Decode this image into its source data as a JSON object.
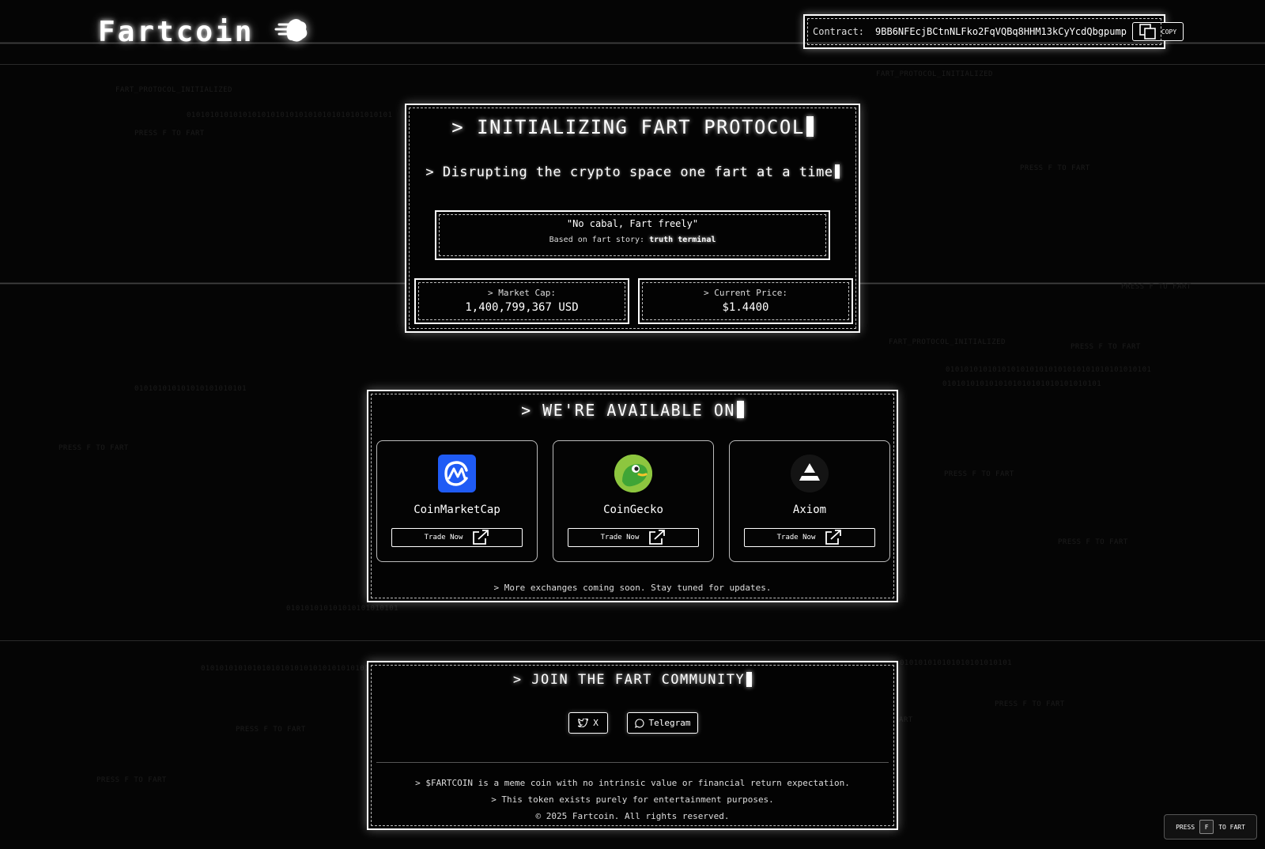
{
  "header": {
    "logo_text": "Fartcoin",
    "logo_icon": "fart-cloud-icon",
    "contract_label": "Contract:",
    "contract_address": "9BB6NFEcjBCtnNLFko2FqVQBq8HHM13kCyYcdQbgpump",
    "copy_label": "COPY"
  },
  "background_text": {
    "protocol": "FART_PROTOCOL_INITIALIZED",
    "press": "PRESS F TO FART",
    "binary_long": "01010101010101010101010101010101010101010101",
    "binary_mid": "0101010101010101010101010101010101",
    "binary_short": "010101010101010101010101"
  },
  "hero": {
    "heading": "> INITIALIZING FART PROTOCOL",
    "tagline": "> Disrupting the crypto space one fart at a time",
    "quote": "\"No cabal, Fart freely\"",
    "story_prefix": "Based on fart story:",
    "story_link": "truth terminal",
    "market_cap_label": "> Market Cap:",
    "market_cap_value": "1,400,799,367 USD",
    "price_label": "> Current Price:",
    "price_value": "$1.4400"
  },
  "exchanges": {
    "heading": "> WE'RE AVAILABLE ON",
    "items": [
      {
        "name": "CoinMarketCap",
        "button": "Trade Now",
        "icon": "coinmarketcap-logo-icon",
        "color": "#1f5bf5"
      },
      {
        "name": "CoinGecko",
        "button": "Trade Now",
        "icon": "coingecko-logo-icon",
        "color": "#8dc63f"
      },
      {
        "name": "Axiom",
        "button": "Trade Now",
        "icon": "axiom-logo-icon",
        "color": "#111111"
      }
    ],
    "note": "> More exchanges coming soon. Stay tuned for updates."
  },
  "community": {
    "heading": "> JOIN THE FART COMMUNITY",
    "x_label": "X",
    "telegram_label": "Telegram",
    "disclaimer_1": "> $FARTCOIN is a meme coin with no intrinsic value or financial return expectation.",
    "disclaimer_2": "> This token exists purely for entertainment purposes.",
    "copyright": "© 2025 Fartcoin. All rights reserved."
  },
  "press_f": {
    "prefix": "PRESS",
    "key": "F",
    "suffix": "TO FART"
  }
}
